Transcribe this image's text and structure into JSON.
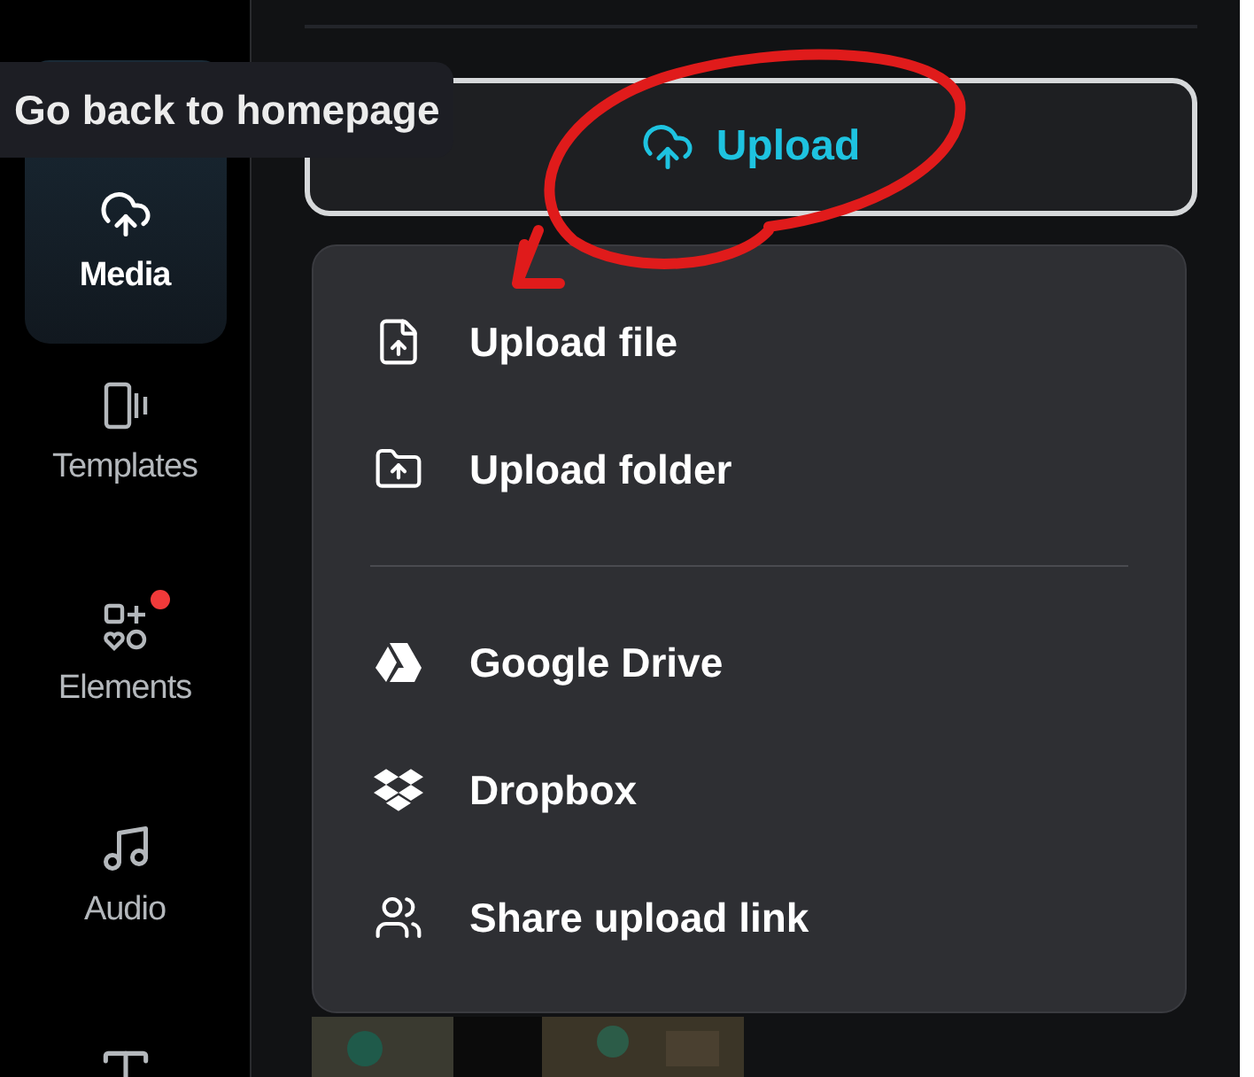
{
  "tooltip": {
    "text": "Go back to homepage"
  },
  "sidebar": {
    "items": [
      {
        "kind": "media",
        "label": "Media",
        "selected": true,
        "notification": false
      },
      {
        "kind": "templates",
        "label": "Templates",
        "selected": false,
        "notification": false
      },
      {
        "kind": "elements",
        "label": "Elements",
        "selected": false,
        "notification": true
      },
      {
        "kind": "audio",
        "label": "Audio",
        "selected": false,
        "notification": false
      },
      {
        "kind": "text",
        "selected": false,
        "notification": false
      }
    ]
  },
  "upload_button": {
    "label": "Upload"
  },
  "upload_menu": {
    "groups": [
      [
        {
          "kind": "file",
          "label": "Upload file"
        },
        {
          "kind": "folder",
          "label": "Upload folder"
        }
      ],
      [
        {
          "kind": "drive",
          "label": "Google Drive"
        },
        {
          "kind": "dropbox",
          "label": "Dropbox"
        },
        {
          "kind": "share",
          "label": "Share upload link"
        }
      ]
    ]
  }
}
